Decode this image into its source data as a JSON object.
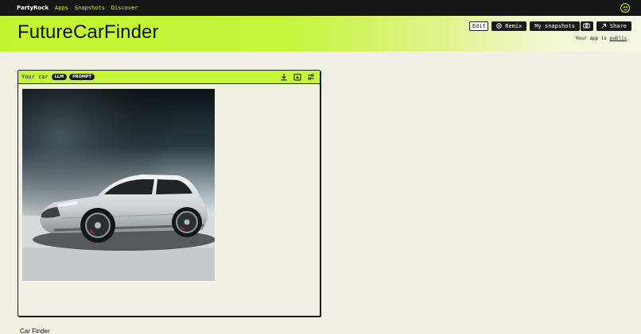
{
  "nav": {
    "brand": "PartyRock",
    "links": [
      "Apps",
      "Snapshots",
      "Discover"
    ],
    "user_icon": "smiley-icon"
  },
  "header": {
    "app_title": "FutureCarFinder",
    "edit_label": "Edit",
    "remix_label": "Remix",
    "snapshots_label": "My snapshots",
    "share_label": "Share",
    "public_prefix": "Your app is",
    "public_link": "public",
    "public_suffix": "."
  },
  "card": {
    "title": "Your car",
    "badges": [
      "LLM",
      "PROMPT"
    ],
    "tools": [
      "download-icon",
      "save-icon",
      "settings-icon"
    ],
    "image": "white-suv-car-image"
  },
  "next_widget": {
    "title": "Car Finder",
    "tool": "settings-icon"
  },
  "colors": {
    "accent": "#c6f53c",
    "dark": "#1a1a1a",
    "background": "#f2efe4"
  }
}
